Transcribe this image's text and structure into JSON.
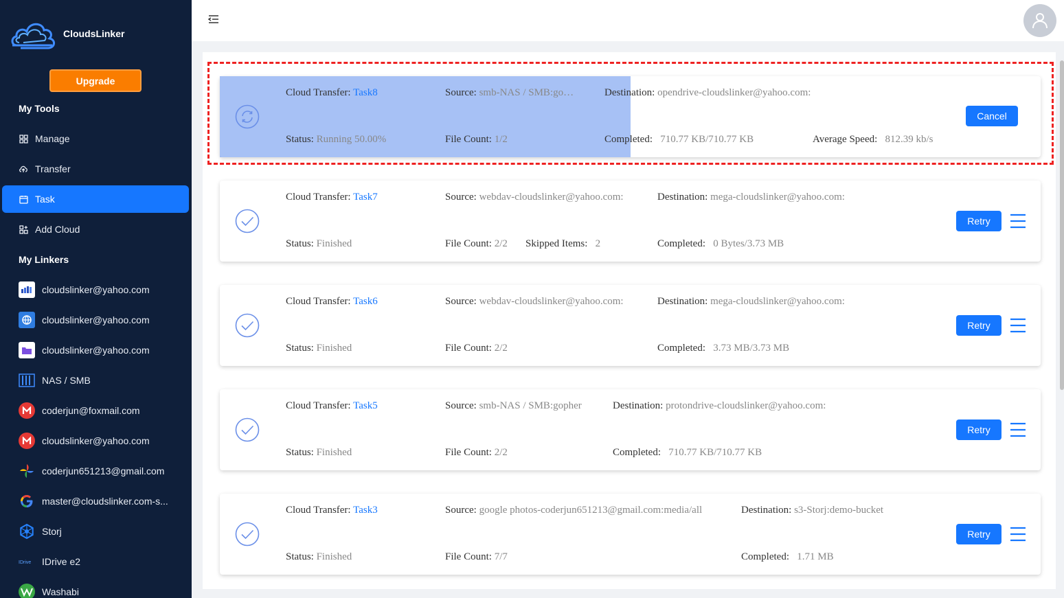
{
  "app": {
    "name": "CloudsLinker",
    "upgrade_label": "Upgrade"
  },
  "sidebar": {
    "my_tools_title": "My Tools",
    "tools": [
      {
        "label": "Manage",
        "icon": "grid-icon"
      },
      {
        "label": "Transfer",
        "icon": "cloud-upload-icon"
      },
      {
        "label": "Task",
        "icon": "calendar-icon",
        "active": true
      },
      {
        "label": "Add Cloud",
        "icon": "add-cloud-icon"
      }
    ],
    "my_linkers_title": "My Linkers",
    "linkers": [
      {
        "label": "cloudslinker@yahoo.com",
        "icon": "opendrive-icon"
      },
      {
        "label": "cloudslinker@yahoo.com",
        "icon": "webdav-icon"
      },
      {
        "label": "cloudslinker@yahoo.com",
        "icon": "protondrive-icon"
      },
      {
        "label": "NAS / SMB",
        "icon": "nas-icon"
      },
      {
        "label": "coderjun@foxmail.com",
        "icon": "mega-icon"
      },
      {
        "label": "cloudslinker@yahoo.com",
        "icon": "mega-icon"
      },
      {
        "label": "coderjun651213@gmail.com",
        "icon": "google-photos-icon"
      },
      {
        "label": "master@cloudslinker.com-s...",
        "icon": "google-icon"
      },
      {
        "label": "Storj",
        "icon": "storj-icon"
      },
      {
        "label": "IDrive e2",
        "icon": "idrive-icon"
      },
      {
        "label": "Washabi",
        "icon": "wasabi-icon"
      }
    ]
  },
  "labels": {
    "cloud_transfer": "Cloud Transfer:",
    "source": "Source:",
    "destination": "Destination:",
    "status": "Status:",
    "file_count": "File Count:",
    "completed": "Completed:",
    "average_speed": "Average Speed:",
    "skipped_items": "Skipped Items:"
  },
  "tasks": [
    {
      "name": "Task8",
      "source": "smb-NAS / SMB:go…",
      "destination": "opendrive-cloudslinker@yahoo.com:",
      "status": "Running 50.00%",
      "progress": 0.5,
      "file_count": "1/2",
      "completed": "710.77 KB/710.77 KB",
      "average_speed": "812.39 kb/s",
      "action": "Cancel",
      "state": "running"
    },
    {
      "name": "Task7",
      "source": "webdav-cloudslinker@yahoo.com:",
      "destination": "mega-cloudslinker@yahoo.com:",
      "status": "Finished",
      "file_count": "2/2",
      "skipped_items": "2",
      "completed": "0 Bytes/3.73 MB",
      "action": "Retry",
      "state": "finished"
    },
    {
      "name": "Task6",
      "source": "webdav-cloudslinker@yahoo.com:",
      "destination": "mega-cloudslinker@yahoo.com:",
      "status": "Finished",
      "file_count": "2/2",
      "completed": "3.73 MB/3.73 MB",
      "action": "Retry",
      "state": "finished"
    },
    {
      "name": "Task5",
      "source": "smb-NAS / SMB:gopher",
      "destination": "protondrive-cloudslinker@yahoo.com:",
      "status": "Finished",
      "file_count": "2/2",
      "completed": "710.77 KB/710.77 KB",
      "action": "Retry",
      "state": "finished"
    },
    {
      "name": "Task3",
      "source": "google photos-coderjun651213@gmail.com:media/all",
      "destination": "s3-Storj:demo-bucket",
      "status": "Finished",
      "file_count": "7/7",
      "completed": "1.71 MB",
      "action": "Retry",
      "state": "finished"
    }
  ],
  "colors": {
    "accent": "#1677ff",
    "sidebar": "#0f1f3a",
    "upgrade": "#fa7d00",
    "highlight": "#ee2222"
  }
}
